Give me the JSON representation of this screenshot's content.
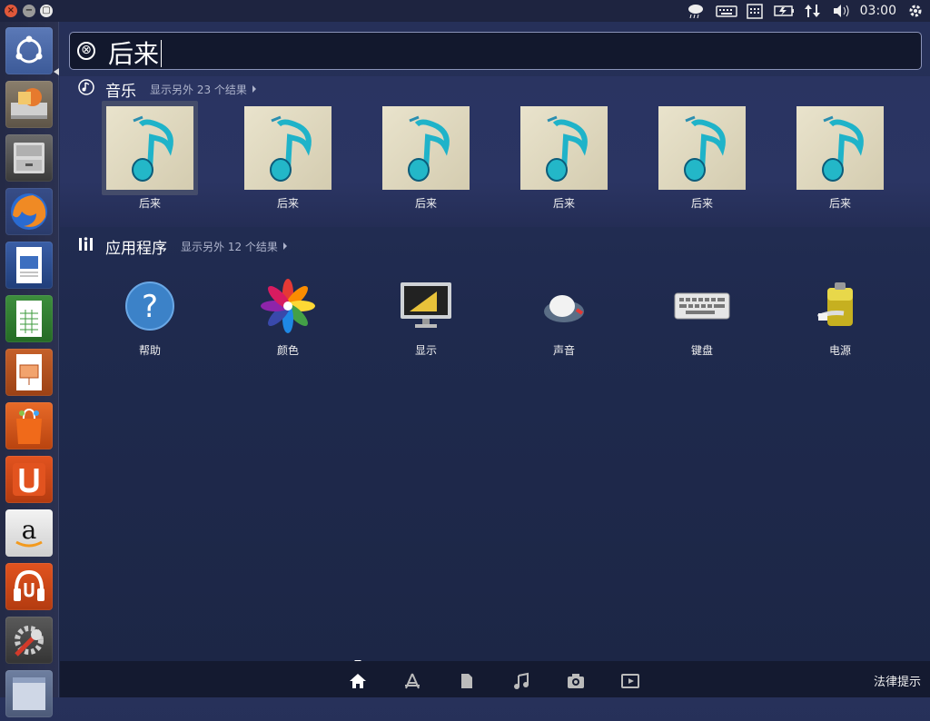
{
  "panel": {
    "window_buttons": {
      "close": "×",
      "minimize": "−",
      "maximize": "▢"
    },
    "indicators": [
      "weather-icon",
      "keyboard-icon",
      "calendar-icon",
      "battery-icon",
      "network-icon",
      "volume-icon"
    ],
    "clock": "03:00"
  },
  "launcher": {
    "items": [
      {
        "name": "dash-home",
        "icon": "ubuntu-logo-icon"
      },
      {
        "name": "software-updater",
        "icon": "installer-icon"
      },
      {
        "name": "files",
        "icon": "file-cabinet-icon"
      },
      {
        "name": "firefox",
        "icon": "firefox-icon"
      },
      {
        "name": "libreoffice-writer",
        "icon": "writer-icon"
      },
      {
        "name": "libreoffice-calc",
        "icon": "calc-icon"
      },
      {
        "name": "libreoffice-impress",
        "icon": "impress-icon"
      },
      {
        "name": "ubuntu-software-center",
        "icon": "shopping-bag-icon"
      },
      {
        "name": "ubuntu-one",
        "icon": "ubuntu-one-icon"
      },
      {
        "name": "amazon",
        "icon": "amazon-icon"
      },
      {
        "name": "ubuntu-one-music",
        "icon": "headphones-icon"
      },
      {
        "name": "system-settings",
        "icon": "settings-wrench-icon"
      },
      {
        "name": "workspace-switcher",
        "icon": "workspaces-icon"
      }
    ]
  },
  "search": {
    "query": "后来",
    "clear_icon": "⊗"
  },
  "music": {
    "title": "音乐",
    "more": "显示另外 23 个结果",
    "items": [
      {
        "label": "后来"
      },
      {
        "label": "后来"
      },
      {
        "label": "后来"
      },
      {
        "label": "后来"
      },
      {
        "label": "后来"
      },
      {
        "label": "后来"
      }
    ]
  },
  "apps": {
    "title": "应用程序",
    "more": "显示另外 12 个结果",
    "items": [
      {
        "label": "帮助",
        "icon": "help-icon"
      },
      {
        "label": "颜色",
        "icon": "color-flower-icon"
      },
      {
        "label": "显示",
        "icon": "display-monitor-icon"
      },
      {
        "label": "声音",
        "icon": "sound-knob-icon"
      },
      {
        "label": "键盘",
        "icon": "keyboard-icon"
      },
      {
        "label": "电源",
        "icon": "battery-power-icon"
      }
    ]
  },
  "lenses": [
    "home-lens-icon",
    "applications-lens-icon",
    "files-lens-icon",
    "music-lens-icon",
    "photos-lens-icon",
    "video-lens-icon"
  ],
  "legal": "法律提示",
  "colors": {
    "background": "#1f2a4e",
    "panel": "#1e2440",
    "accent": "#e0583a"
  }
}
